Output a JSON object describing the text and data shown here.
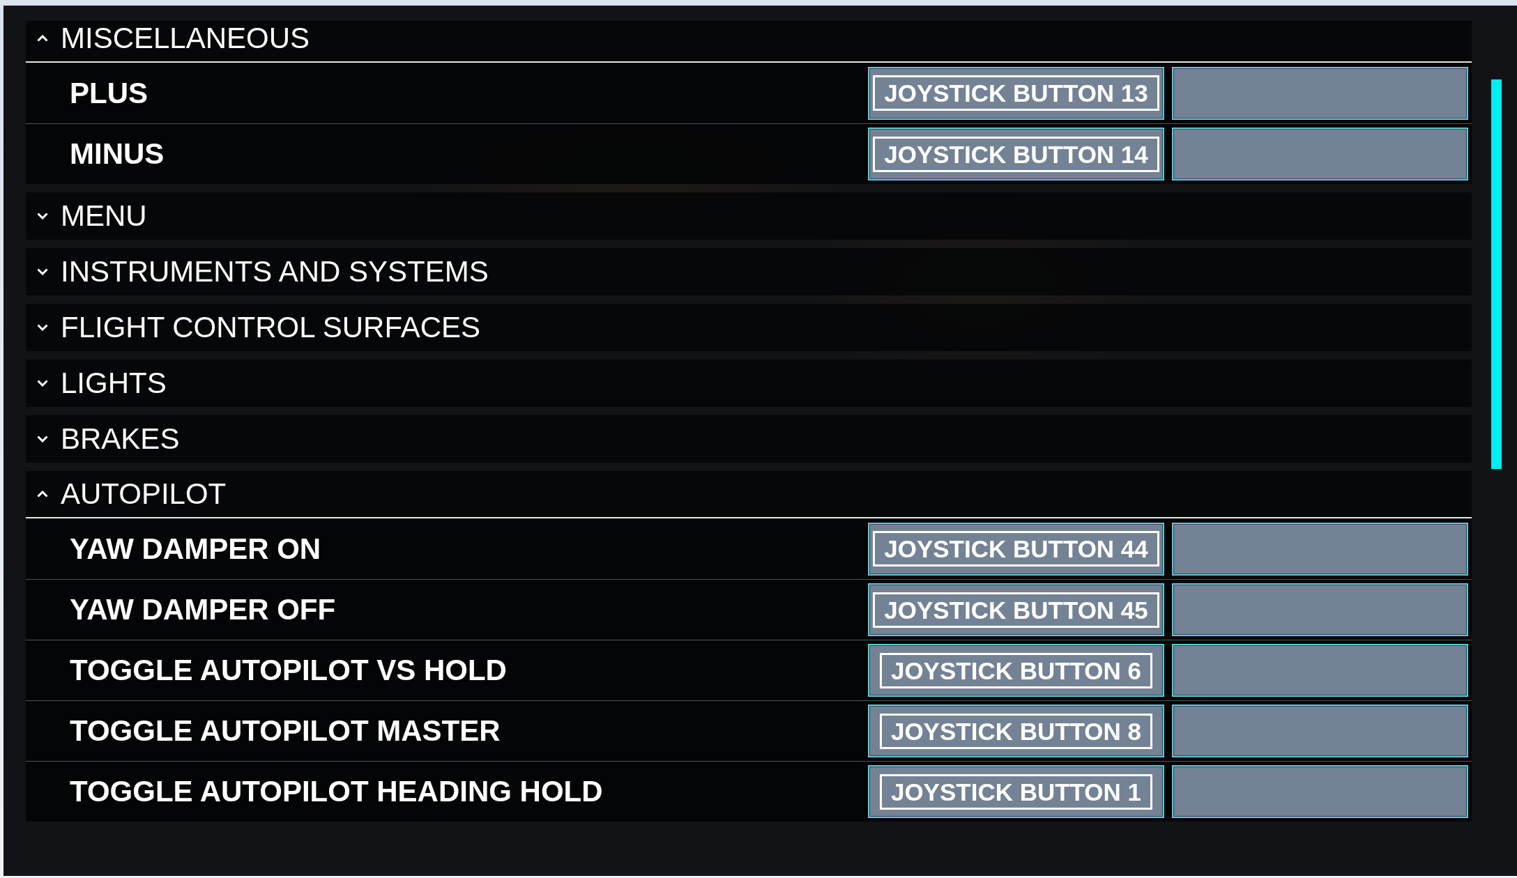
{
  "groups": [
    {
      "title": "MISCELLANEOUS",
      "expanded": true,
      "actions": [
        {
          "label": "PLUS",
          "binding": "JOYSTICK BUTTON 13"
        },
        {
          "label": "MINUS",
          "binding": "JOYSTICK BUTTON 14"
        }
      ]
    },
    {
      "title": "MENU",
      "expanded": false
    },
    {
      "title": "INSTRUMENTS AND SYSTEMS",
      "expanded": false
    },
    {
      "title": "FLIGHT CONTROL SURFACES",
      "expanded": false
    },
    {
      "title": "LIGHTS",
      "expanded": false
    },
    {
      "title": "BRAKES",
      "expanded": false
    },
    {
      "title": "AUTOPILOT",
      "expanded": true,
      "actions": [
        {
          "label": "YAW DAMPER ON",
          "binding": "JOYSTICK BUTTON 44"
        },
        {
          "label": "YAW DAMPER OFF",
          "binding": "JOYSTICK BUTTON 45"
        },
        {
          "label": "TOGGLE AUTOPILOT VS HOLD",
          "binding": "JOYSTICK BUTTON 6"
        },
        {
          "label": "TOGGLE AUTOPILOT MASTER",
          "binding": "JOYSTICK BUTTON 8"
        },
        {
          "label": "TOGGLE AUTOPILOT HEADING HOLD",
          "binding": "JOYSTICK BUTTON 1"
        }
      ]
    }
  ]
}
